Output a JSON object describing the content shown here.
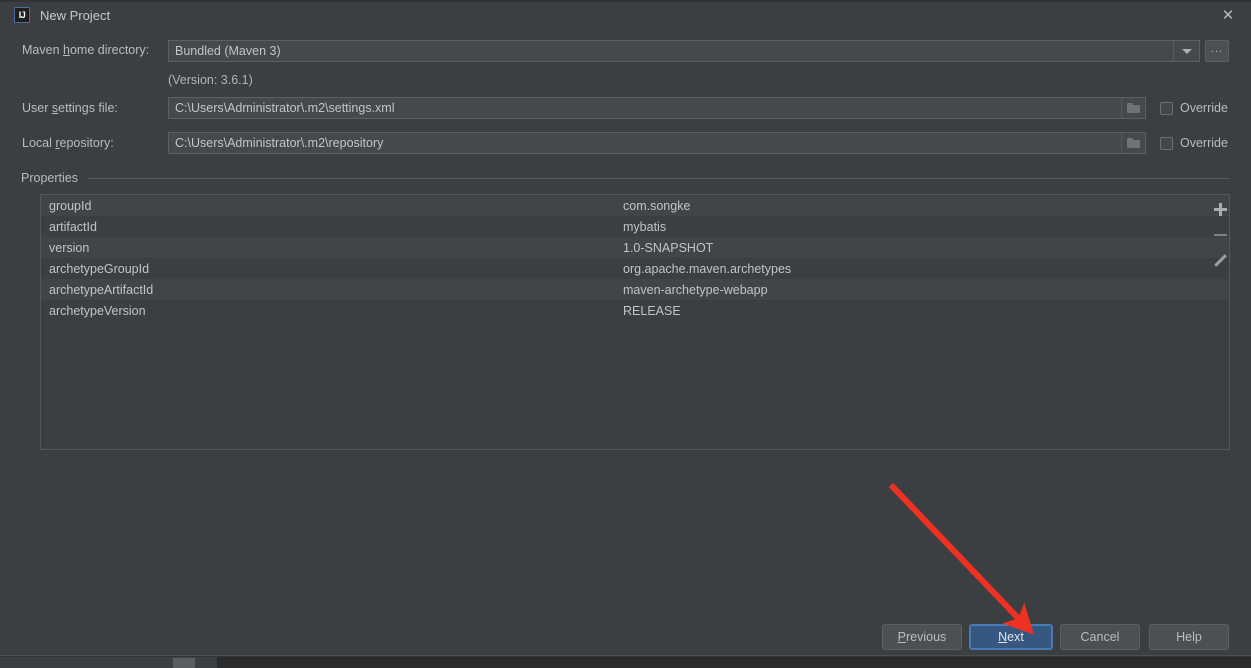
{
  "window": {
    "title": "New Project",
    "app_icon": "intellij-idea-icon",
    "close_icon": "close-icon"
  },
  "form": {
    "maven_home": {
      "label_pre": "Maven ",
      "label_mnemonic": "h",
      "label_post": "ome directory:",
      "label_full": "Maven home directory:",
      "value": "Bundled (Maven 3)",
      "browse_label": "...",
      "version_note": "(Version: 3.6.1)"
    },
    "user_settings": {
      "label_pre": "User ",
      "label_mnemonic": "s",
      "label_post": "ettings file:",
      "label_full": "User settings file:",
      "value": "C:\\Users\\Administrator\\.m2\\settings.xml",
      "override_label": "Override",
      "override_checked": false
    },
    "local_repository": {
      "label_pre": "Local ",
      "label_mnemonic": "r",
      "label_post": "epository:",
      "label_full": "Local repository:",
      "value": "C:\\Users\\Administrator\\.m2\\repository",
      "override_label": "Override",
      "override_checked": false
    }
  },
  "properties": {
    "group_title": "Properties",
    "rows": [
      {
        "key": "groupId",
        "value": "com.songke"
      },
      {
        "key": "artifactId",
        "value": "mybatis"
      },
      {
        "key": "version",
        "value": "1.0-SNAPSHOT"
      },
      {
        "key": "archetypeGroupId",
        "value": "org.apache.maven.archetypes"
      },
      {
        "key": "archetypeArtifactId",
        "value": "maven-archetype-webapp"
      },
      {
        "key": "archetypeVersion",
        "value": "RELEASE"
      }
    ],
    "tools": {
      "add": "add-property-button",
      "remove": "remove-property-button",
      "edit": "edit-property-button"
    }
  },
  "footer": {
    "previous": {
      "pre": "",
      "mnemonic": "P",
      "post": "revious",
      "full": "Previous"
    },
    "next": {
      "pre": "",
      "mnemonic": "N",
      "post": "ext",
      "full": "Next"
    },
    "cancel": {
      "full": "Cancel"
    },
    "help": {
      "full": "Help"
    }
  },
  "annotation": {
    "arrow_color": "#ee3123",
    "type": "red-arrow-pointing-to-next-button"
  },
  "colors": {
    "background": "#3c3f41",
    "field_bg": "#45494a",
    "accent_primary": "#365880",
    "accent_border": "#4a7ab5",
    "text": "#bbbbbb",
    "row_stripe": "#414547"
  }
}
